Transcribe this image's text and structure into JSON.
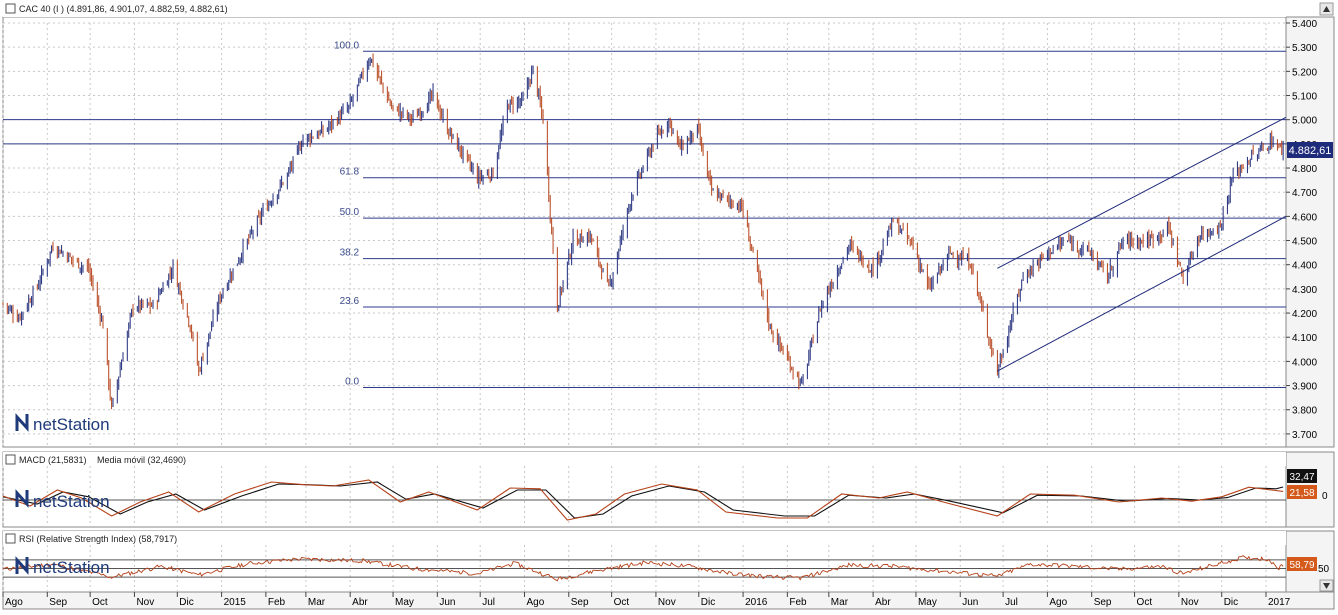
{
  "colors": {
    "up": "#1e2a7a",
    "down": "#b5421a",
    "fib_line": "#2c3a8c",
    "trend": "#1e2a7a",
    "grid": "#c8c8c8",
    "macd": "#b5421a",
    "signal": "#111111",
    "rsi": "#b5421a",
    "price_tag_bg": "#1e2a7a",
    "macd_tag_bg": "#111111",
    "signal_tag_bg": "#d35a1a",
    "rsi_tag_bg": "#d35a1a",
    "logo_text": "#1e3a7a"
  },
  "icons": {
    "scroll_up": "up-arrow-icon",
    "scroll_down": "down-arrow-icon",
    "logo": "netstation-logo-icon"
  },
  "logo": {
    "text": "netStation"
  },
  "price_panel": {
    "header": "CAC 40 (I ) (4.891,86, 4.901,07, 4.882,59, 4.882,61)",
    "last_price_label": "4.882,61"
  },
  "macd_panel": {
    "header_macd": "MACD (21,5831)",
    "header_signal": "Media móvil (32,4690)",
    "tag_macd": "32,47",
    "tag_signal": "21,58",
    "zero_label": "0"
  },
  "rsi_panel": {
    "header": "RSI (Relative Strength Index) (58,7917)",
    "tag": "58,79",
    "level_label": "50"
  },
  "chart_data": {
    "type": "candlestick",
    "title": "CAC 40 (I )",
    "last_ohlc": {
      "open": 4891.86,
      "high": 4901.07,
      "low": 4882.59,
      "close": 4882.61
    },
    "x_range": [
      "2014-08-01",
      "2017-01-15"
    ],
    "x_tick_labels": [
      "Ago",
      "Sep",
      "Oct",
      "Nov",
      "Dic",
      "2015",
      "Feb",
      "Mar",
      "Abr",
      "May",
      "Jun",
      "Jul",
      "Ago",
      "Sep",
      "Oct",
      "Nov",
      "Dic",
      "2016",
      "Feb",
      "Mar",
      "Abr",
      "May",
      "Jun",
      "Jul",
      "Ago",
      "Sep",
      "Oct",
      "Nov",
      "Dic",
      "2017"
    ],
    "x_tick_dates": [
      "2014-08-01",
      "2014-09-01",
      "2014-10-01",
      "2014-11-01",
      "2014-12-01",
      "2015-01-01",
      "2015-02-01",
      "2015-03-01",
      "2015-04-01",
      "2015-05-01",
      "2015-06-01",
      "2015-07-01",
      "2015-08-01",
      "2015-09-01",
      "2015-10-01",
      "2015-11-01",
      "2015-12-01",
      "2016-01-01",
      "2016-02-01",
      "2016-03-01",
      "2016-04-01",
      "2016-05-01",
      "2016-06-01",
      "2016-07-01",
      "2016-08-01",
      "2016-09-01",
      "2016-10-01",
      "2016-11-01",
      "2016-12-01",
      "2017-01-01"
    ],
    "y_range": [
      3650,
      5400
    ],
    "y_ticks": [
      3700,
      3800,
      3900,
      4000,
      4100,
      4200,
      4300,
      4400,
      4500,
      4600,
      4700,
      4800,
      4900,
      5000,
      5100,
      5200,
      5300,
      5400
    ],
    "y_tick_labels": [
      "3.700",
      "3.800",
      "3.900",
      "4.000",
      "4.100",
      "4.200",
      "4.300",
      "4.400",
      "4.500",
      "4.600",
      "4.700",
      "4.800",
      "4.900",
      "5.000",
      "5.100",
      "5.200",
      "5.300",
      "5.400"
    ],
    "price_path": [
      [
        "2014-08-01",
        4240
      ],
      [
        "2014-08-12",
        4180
      ],
      [
        "2014-08-25",
        4310
      ],
      [
        "2014-09-05",
        4480
      ],
      [
        "2014-09-19",
        4420
      ],
      [
        "2014-09-30",
        4380
      ],
      [
        "2014-10-10",
        4150
      ],
      [
        "2014-10-16",
        3800
      ],
      [
        "2014-10-31",
        4230
      ],
      [
        "2014-11-14",
        4230
      ],
      [
        "2014-11-28",
        4390
      ],
      [
        "2014-12-10",
        4150
      ],
      [
        "2014-12-16",
        3960
      ],
      [
        "2014-12-31",
        4270
      ],
      [
        "2015-01-15",
        4450
      ],
      [
        "2015-01-30",
        4620
      ],
      [
        "2015-02-16",
        4770
      ],
      [
        "2015-02-27",
        4920
      ],
      [
        "2015-03-13",
        4950
      ],
      [
        "2015-03-31",
        5050
      ],
      [
        "2015-04-15",
        5260
      ],
      [
        "2015-04-30",
        5050
      ],
      [
        "2015-05-15",
        5000
      ],
      [
        "2015-05-29",
        5100
      ],
      [
        "2015-06-09",
        4950
      ],
      [
        "2015-06-29",
        4760
      ],
      [
        "2015-07-10",
        4780
      ],
      [
        "2015-07-20",
        5060
      ],
      [
        "2015-07-31",
        5080
      ],
      [
        "2015-08-07",
        5210
      ],
      [
        "2015-08-14",
        5000
      ],
      [
        "2015-08-24",
        4230
      ],
      [
        "2015-09-04",
        4500
      ],
      [
        "2015-09-16",
        4520
      ],
      [
        "2015-09-29",
        4300
      ],
      [
        "2015-10-15",
        4690
      ],
      [
        "2015-10-30",
        4900
      ],
      [
        "2015-11-10",
        5000
      ],
      [
        "2015-11-18",
        4880
      ],
      [
        "2015-11-30",
        4960
      ],
      [
        "2015-12-10",
        4700
      ],
      [
        "2015-12-31",
        4640
      ],
      [
        "2016-01-20",
        4140
      ],
      [
        "2016-02-11",
        3900
      ],
      [
        "2016-02-24",
        4220
      ],
      [
        "2016-03-15",
        4480
      ],
      [
        "2016-04-01",
        4380
      ],
      [
        "2016-04-15",
        4580
      ],
      [
        "2016-04-29",
        4480
      ],
      [
        "2016-05-10",
        4300
      ],
      [
        "2016-05-25",
        4450
      ],
      [
        "2016-06-08",
        4410
      ],
      [
        "2016-06-24",
        4030
      ],
      [
        "2016-06-27",
        3960
      ],
      [
        "2016-07-15",
        4350
      ],
      [
        "2016-08-01",
        4450
      ],
      [
        "2016-08-15",
        4500
      ],
      [
        "2016-08-31",
        4450
      ],
      [
        "2016-09-12",
        4350
      ],
      [
        "2016-09-23",
        4500
      ],
      [
        "2016-10-10",
        4500
      ],
      [
        "2016-10-25",
        4550
      ],
      [
        "2016-11-04",
        4340
      ],
      [
        "2016-11-15",
        4520
      ],
      [
        "2016-11-30",
        4560
      ],
      [
        "2016-12-09",
        4770
      ],
      [
        "2016-12-21",
        4840
      ],
      [
        "2016-12-30",
        4880
      ],
      [
        "2017-01-06",
        4920
      ],
      [
        "2017-01-10",
        4880
      ],
      [
        "2017-01-13",
        4882.61
      ]
    ],
    "horizontal_levels": [
      5000,
      4900
    ],
    "fibonacci": {
      "start_date": "2015-04-10",
      "levels": [
        {
          "label": "100.0",
          "value": 5283
        },
        {
          "label": "61.8",
          "value": 4760
        },
        {
          "label": "50.0",
          "value": 4593
        },
        {
          "label": "38.2",
          "value": 4425
        },
        {
          "label": "23.6",
          "value": 4225
        },
        {
          "label": "0.0",
          "value": 3892
        }
      ]
    },
    "trend_channel": [
      [
        [
          "2016-06-27",
          3960
        ],
        [
          "2017-01-15",
          4600
        ]
      ],
      [
        [
          "2016-06-27",
          4385
        ],
        [
          "2017-01-15",
          5010
        ]
      ]
    ],
    "macd": {
      "zero_label": "0",
      "ylim": [
        -60,
        80
      ],
      "macd_path": [
        [
          "2014-08-01",
          10
        ],
        [
          "2014-08-20",
          -15
        ],
        [
          "2014-09-08",
          25
        ],
        [
          "2014-09-25",
          5
        ],
        [
          "2014-10-16",
          -40
        ],
        [
          "2014-11-05",
          -5
        ],
        [
          "2014-11-25",
          20
        ],
        [
          "2014-12-16",
          -30
        ],
        [
          "2015-01-10",
          15
        ],
        [
          "2015-02-05",
          45
        ],
        [
          "2015-03-01",
          38
        ],
        [
          "2015-03-20",
          35
        ],
        [
          "2015-04-14",
          50
        ],
        [
          "2015-05-06",
          -5
        ],
        [
          "2015-05-26",
          20
        ],
        [
          "2015-06-29",
          -25
        ],
        [
          "2015-07-22",
          30
        ],
        [
          "2015-08-12",
          28
        ],
        [
          "2015-08-31",
          -50
        ],
        [
          "2015-09-20",
          -35
        ],
        [
          "2015-10-10",
          15
        ],
        [
          "2015-11-05",
          40
        ],
        [
          "2015-11-30",
          25
        ],
        [
          "2015-12-20",
          -30
        ],
        [
          "2016-01-25",
          -45
        ],
        [
          "2016-02-15",
          -45
        ],
        [
          "2016-03-10",
          15
        ],
        [
          "2016-04-05",
          5
        ],
        [
          "2016-04-25",
          20
        ],
        [
          "2016-05-20",
          -5
        ],
        [
          "2016-06-27",
          -40
        ],
        [
          "2016-07-20",
          15
        ],
        [
          "2016-08-20",
          12
        ],
        [
          "2016-09-20",
          -5
        ],
        [
          "2016-10-20",
          5
        ],
        [
          "2016-11-10",
          -3
        ],
        [
          "2016-12-01",
          8
        ],
        [
          "2016-12-20",
          32
        ],
        [
          "2017-01-05",
          25
        ],
        [
          "2017-01-13",
          21.58
        ]
      ],
      "signal_path": [
        [
          "2014-08-01",
          8
        ],
        [
          "2014-08-25",
          -10
        ],
        [
          "2014-09-12",
          20
        ],
        [
          "2014-09-30",
          8
        ],
        [
          "2014-10-22",
          -35
        ],
        [
          "2014-11-10",
          -5
        ],
        [
          "2014-11-30",
          15
        ],
        [
          "2014-12-20",
          -25
        ],
        [
          "2015-01-15",
          10
        ],
        [
          "2015-02-10",
          40
        ],
        [
          "2015-03-05",
          38
        ],
        [
          "2015-03-25",
          35
        ],
        [
          "2015-04-20",
          45
        ],
        [
          "2015-05-10",
          2
        ],
        [
          "2015-05-30",
          15
        ],
        [
          "2015-07-03",
          -20
        ],
        [
          "2015-07-27",
          25
        ],
        [
          "2015-08-16",
          25
        ],
        [
          "2015-09-05",
          -45
        ],
        [
          "2015-09-25",
          -35
        ],
        [
          "2015-10-15",
          10
        ],
        [
          "2015-11-10",
          35
        ],
        [
          "2015-12-05",
          20
        ],
        [
          "2015-12-25",
          -25
        ],
        [
          "2016-01-30",
          -40
        ],
        [
          "2016-02-20",
          -40
        ],
        [
          "2016-03-15",
          12
        ],
        [
          "2016-04-10",
          5
        ],
        [
          "2016-04-30",
          15
        ],
        [
          "2016-05-25",
          -3
        ],
        [
          "2016-07-01",
          -32
        ],
        [
          "2016-07-25",
          12
        ],
        [
          "2016-08-25",
          10
        ],
        [
          "2016-09-25",
          -3
        ],
        [
          "2016-10-25",
          4
        ],
        [
          "2016-11-15",
          0
        ],
        [
          "2016-12-05",
          6
        ],
        [
          "2016-12-25",
          30
        ],
        [
          "2017-01-08",
          28
        ],
        [
          "2017-01-13",
          32.47
        ]
      ]
    },
    "rsi": {
      "ylim": [
        0,
        100
      ],
      "levels": [
        70,
        50,
        30
      ],
      "level_label": "50",
      "path": [
        [
          "2014-08-01",
          48
        ],
        [
          "2014-09-05",
          60
        ],
        [
          "2014-10-16",
          30
        ],
        [
          "2014-11-20",
          55
        ],
        [
          "2014-12-16",
          35
        ],
        [
          "2015-01-20",
          62
        ],
        [
          "2015-02-25",
          72
        ],
        [
          "2015-04-10",
          68
        ],
        [
          "2015-05-15",
          50
        ],
        [
          "2015-06-29",
          38
        ],
        [
          "2015-07-25",
          62
        ],
        [
          "2015-08-24",
          25
        ],
        [
          "2015-09-20",
          45
        ],
        [
          "2015-10-25",
          64
        ],
        [
          "2015-11-25",
          55
        ],
        [
          "2015-12-20",
          40
        ],
        [
          "2016-01-20",
          30
        ],
        [
          "2016-02-11",
          28
        ],
        [
          "2016-03-15",
          58
        ],
        [
          "2016-04-15",
          55
        ],
        [
          "2016-05-15",
          45
        ],
        [
          "2016-06-27",
          32
        ],
        [
          "2016-07-20",
          60
        ],
        [
          "2016-08-20",
          55
        ],
        [
          "2016-09-20",
          48
        ],
        [
          "2016-10-20",
          55
        ],
        [
          "2016-11-04",
          38
        ],
        [
          "2016-11-25",
          58
        ],
        [
          "2016-12-15",
          75
        ],
        [
          "2017-01-03",
          72
        ],
        [
          "2017-01-10",
          50
        ],
        [
          "2017-01-13",
          58.79
        ]
      ]
    }
  }
}
